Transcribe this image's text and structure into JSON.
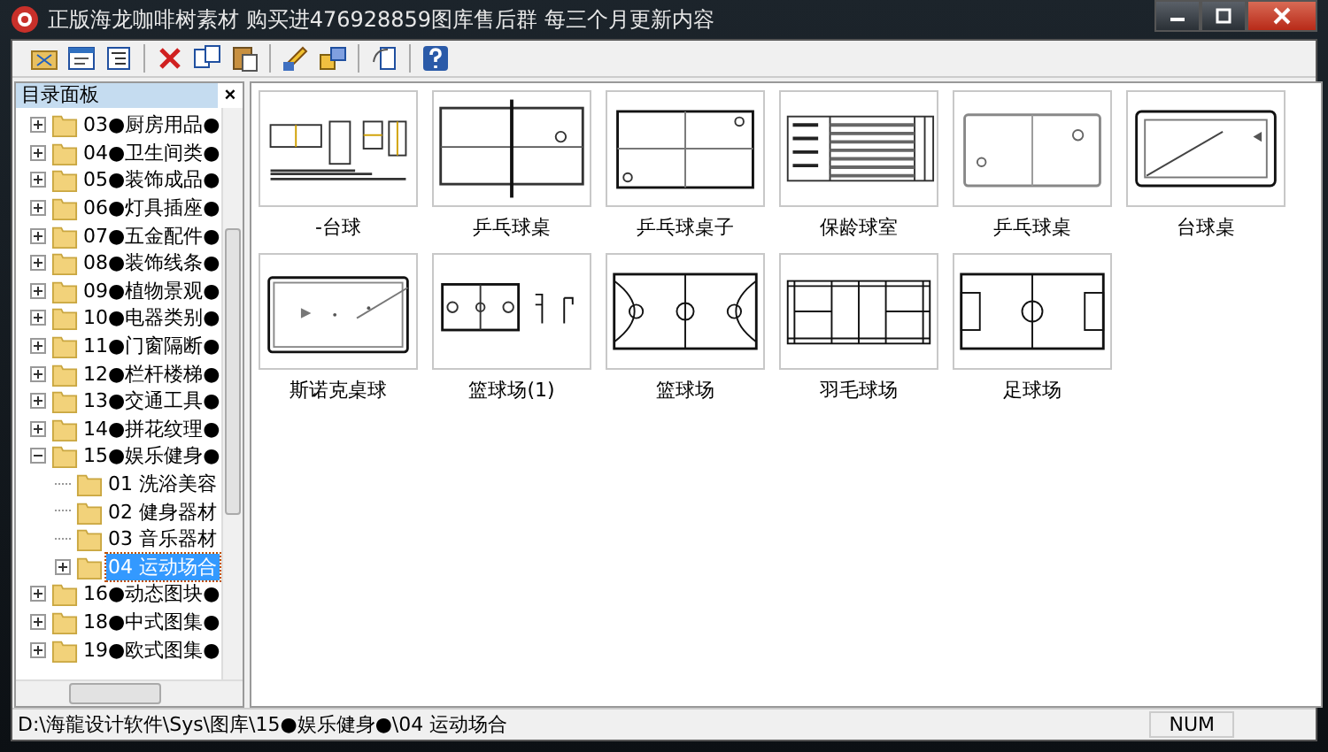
{
  "window": {
    "title": "正版海龙咖啡树素材 购买进476928859图库售后群 每三个月更新内容"
  },
  "panel": {
    "title": "目录面板",
    "close": "×"
  },
  "tree": [
    {
      "label": "03●厨房用品●",
      "expanded": false,
      "selected": false
    },
    {
      "label": "04●卫生间类●",
      "expanded": false,
      "selected": false
    },
    {
      "label": "05●装饰成品●",
      "expanded": false,
      "selected": false
    },
    {
      "label": "06●灯具插座●",
      "expanded": false,
      "selected": false
    },
    {
      "label": "07●五金配件●",
      "expanded": false,
      "selected": false
    },
    {
      "label": "08●装饰线条●",
      "expanded": false,
      "selected": false
    },
    {
      "label": "09●植物景观●",
      "expanded": false,
      "selected": false
    },
    {
      "label": "10●电器类别●",
      "expanded": false,
      "selected": false
    },
    {
      "label": "11●门窗隔断●",
      "expanded": false,
      "selected": false
    },
    {
      "label": "12●栏杆楼梯●",
      "expanded": false,
      "selected": false
    },
    {
      "label": "13●交通工具●",
      "expanded": false,
      "selected": false
    },
    {
      "label": "14●拼花纹理●",
      "expanded": false,
      "selected": false
    },
    {
      "label": "15●娱乐健身●",
      "expanded": true,
      "selected": false,
      "children": [
        {
          "label": "01 洗浴美容",
          "selected": false
        },
        {
          "label": "02 健身器材",
          "selected": false
        },
        {
          "label": "03 音乐器材",
          "selected": false
        },
        {
          "label": "04 运动场合",
          "expanded": false,
          "selected": true
        }
      ]
    },
    {
      "label": "16●动态图块●",
      "expanded": false,
      "selected": false
    },
    {
      "label": "18●中式图集●",
      "expanded": false,
      "selected": false
    },
    {
      "label": "19●欧式图集●",
      "expanded": false,
      "selected": false
    }
  ],
  "thumbnails": [
    {
      "label": "-台球",
      "kind": "billiards-set"
    },
    {
      "label": "乒乓球桌",
      "kind": "pingpong-net"
    },
    {
      "label": "乒乓球桌子",
      "kind": "pingpong-table"
    },
    {
      "label": "保龄球室",
      "kind": "bowling"
    },
    {
      "label": "乒乓球桌",
      "kind": "pingpong-plain"
    },
    {
      "label": "台球桌",
      "kind": "pool-table"
    },
    {
      "label": "斯诺克桌球",
      "kind": "snooker"
    },
    {
      "label": "篮球场(1)",
      "kind": "basketball-set"
    },
    {
      "label": "篮球场",
      "kind": "basketball"
    },
    {
      "label": "羽毛球场",
      "kind": "badminton"
    },
    {
      "label": "足球场",
      "kind": "football"
    }
  ],
  "status_bar": {
    "path": "D:\\海龍设计软件\\Sys\\图库\\15●娱乐健身●\\04 运动场合",
    "indicator": "NUM"
  }
}
